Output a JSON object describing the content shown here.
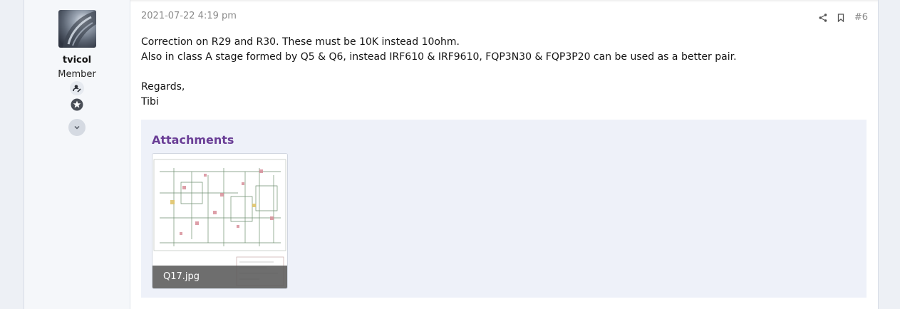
{
  "user": {
    "username": "tvicol",
    "title": "Member",
    "avatar_icon": "avatar-image",
    "banner_icons": [
      "user-edit-icon",
      "star-circle-icon",
      "chevron-down-icon"
    ]
  },
  "post": {
    "date": "2021-07-22 4:19 pm",
    "number": "#6",
    "actions": [
      "share-icon",
      "bookmark-icon"
    ],
    "lines": [
      "Correction on R29 and R30. These must be 10K instead 10ohm.",
      "Also in class A stage formed by Q5 & Q6, instead IRF610 & IRF9610, FQP3N30 & FQP3P20 can be used as a better pair.",
      "",
      "Regards,",
      "Tibi"
    ]
  },
  "attachments": {
    "title": "Attachments",
    "items": [
      {
        "filename": "Q17.jpg"
      }
    ]
  },
  "colors": {
    "accent": "#6a3e96",
    "attachment_bg": "#eef1f9",
    "muted_text": "#8a8a8a"
  }
}
